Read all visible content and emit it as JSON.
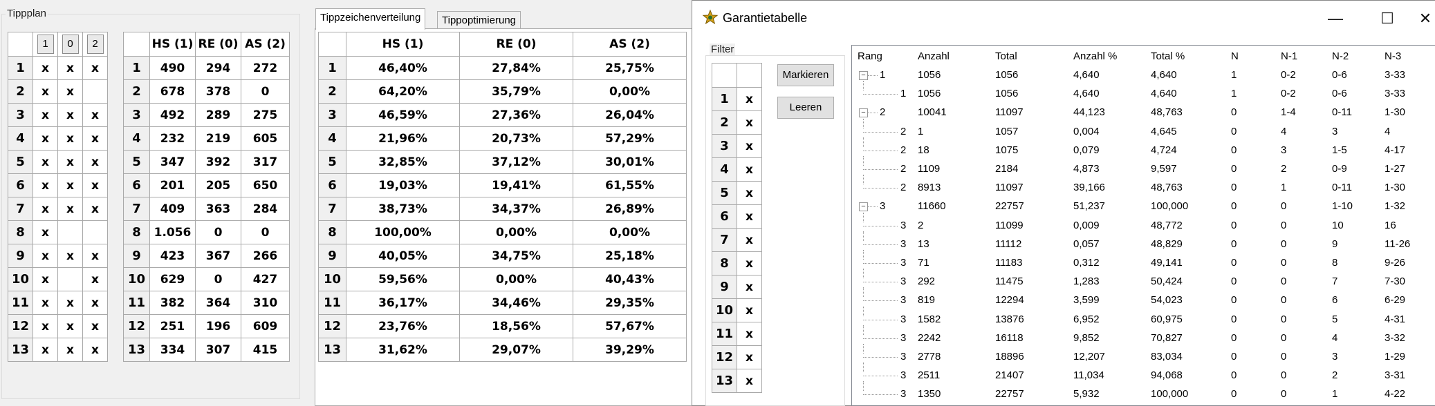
{
  "tippplan": {
    "title": "Tippplan",
    "headers": [
      "1",
      "0",
      "2"
    ],
    "rows": [
      {
        "n": "1",
        "c": [
          "x",
          "x",
          "x"
        ]
      },
      {
        "n": "2",
        "c": [
          "x",
          "x",
          ""
        ]
      },
      {
        "n": "3",
        "c": [
          "x",
          "x",
          "x"
        ]
      },
      {
        "n": "4",
        "c": [
          "x",
          "x",
          "x"
        ]
      },
      {
        "n": "5",
        "c": [
          "x",
          "x",
          "x"
        ]
      },
      {
        "n": "6",
        "c": [
          "x",
          "x",
          "x"
        ]
      },
      {
        "n": "7",
        "c": [
          "x",
          "x",
          "x"
        ]
      },
      {
        "n": "8",
        "c": [
          "x",
          "",
          ""
        ]
      },
      {
        "n": "9",
        "c": [
          "x",
          "x",
          "x"
        ]
      },
      {
        "n": "10",
        "c": [
          "x",
          "",
          "x"
        ]
      },
      {
        "n": "11",
        "c": [
          "x",
          "x",
          "x"
        ]
      },
      {
        "n": "12",
        "c": [
          "x",
          "x",
          "x"
        ]
      },
      {
        "n": "13",
        "c": [
          "x",
          "x",
          "x"
        ]
      }
    ]
  },
  "counts": {
    "headers": [
      "HS (1)",
      "RE (0)",
      "AS (2)"
    ],
    "rows": [
      {
        "n": "1",
        "c": [
          "490",
          "294",
          "272"
        ]
      },
      {
        "n": "2",
        "c": [
          "678",
          "378",
          "0"
        ]
      },
      {
        "n": "3",
        "c": [
          "492",
          "289",
          "275"
        ]
      },
      {
        "n": "4",
        "c": [
          "232",
          "219",
          "605"
        ]
      },
      {
        "n": "5",
        "c": [
          "347",
          "392",
          "317"
        ]
      },
      {
        "n": "6",
        "c": [
          "201",
          "205",
          "650"
        ]
      },
      {
        "n": "7",
        "c": [
          "409",
          "363",
          "284"
        ]
      },
      {
        "n": "8",
        "c": [
          "1.056",
          "0",
          "0"
        ]
      },
      {
        "n": "9",
        "c": [
          "423",
          "367",
          "266"
        ]
      },
      {
        "n": "10",
        "c": [
          "629",
          "0",
          "427"
        ]
      },
      {
        "n": "11",
        "c": [
          "382",
          "364",
          "310"
        ]
      },
      {
        "n": "12",
        "c": [
          "251",
          "196",
          "609"
        ]
      },
      {
        "n": "13",
        "c": [
          "334",
          "307",
          "415"
        ]
      }
    ]
  },
  "tabs": {
    "items": [
      "Tippzeichenverteilung",
      "Tippoptimierung"
    ]
  },
  "percent": {
    "headers": [
      "HS (1)",
      "RE (0)",
      "AS (2)"
    ],
    "rows": [
      {
        "n": "1",
        "c": [
          "46,40%",
          "27,84%",
          "25,75%"
        ]
      },
      {
        "n": "2",
        "c": [
          "64,20%",
          "35,79%",
          "0,00%"
        ]
      },
      {
        "n": "3",
        "c": [
          "46,59%",
          "27,36%",
          "26,04%"
        ]
      },
      {
        "n": "4",
        "c": [
          "21,96%",
          "20,73%",
          "57,29%"
        ]
      },
      {
        "n": "5",
        "c": [
          "32,85%",
          "37,12%",
          "30,01%"
        ]
      },
      {
        "n": "6",
        "c": [
          "19,03%",
          "19,41%",
          "61,55%"
        ]
      },
      {
        "n": "7",
        "c": [
          "38,73%",
          "34,37%",
          "26,89%"
        ]
      },
      {
        "n": "8",
        "c": [
          "100,00%",
          "0,00%",
          "0,00%"
        ]
      },
      {
        "n": "9",
        "c": [
          "40,05%",
          "34,75%",
          "25,18%"
        ]
      },
      {
        "n": "10",
        "c": [
          "59,56%",
          "0,00%",
          "40,43%"
        ]
      },
      {
        "n": "11",
        "c": [
          "36,17%",
          "34,46%",
          "29,35%"
        ]
      },
      {
        "n": "12",
        "c": [
          "23,76%",
          "18,56%",
          "57,67%"
        ]
      },
      {
        "n": "13",
        "c": [
          "31,62%",
          "29,07%",
          "39,29%"
        ]
      }
    ]
  },
  "dialog": {
    "title": "Garantietabelle",
    "controls": {
      "minimize": "—",
      "maximize": "☐",
      "close": "✕"
    },
    "filter": {
      "title": "Filter",
      "rows": [
        {
          "n": "1",
          "v": "x"
        },
        {
          "n": "2",
          "v": "x"
        },
        {
          "n": "3",
          "v": "x"
        },
        {
          "n": "4",
          "v": "x"
        },
        {
          "n": "5",
          "v": "x"
        },
        {
          "n": "6",
          "v": "x"
        },
        {
          "n": "7",
          "v": "x"
        },
        {
          "n": "8",
          "v": "x"
        },
        {
          "n": "9",
          "v": "x"
        },
        {
          "n": "10",
          "v": "x"
        },
        {
          "n": "11",
          "v": "x"
        },
        {
          "n": "12",
          "v": "x"
        },
        {
          "n": "13",
          "v": "x"
        }
      ]
    },
    "buttons": {
      "mark": "Markieren",
      "clear": "Leeren"
    },
    "tree": {
      "columns": [
        "Rang",
        "Anzahl",
        "Total",
        "Anzahl %",
        "Total %",
        "N",
        "N-1",
        "N-2",
        "N-3"
      ],
      "rows": [
        {
          "group": true,
          "rang": "1",
          "c": [
            "1056",
            "1056",
            "4,640",
            "4,640",
            "1",
            "0-2",
            "0-6",
            "3-33"
          ]
        },
        {
          "group": false,
          "rang": "1",
          "c": [
            "1056",
            "1056",
            "4,640",
            "4,640",
            "1",
            "0-2",
            "0-6",
            "3-33"
          ]
        },
        {
          "group": true,
          "rang": "2",
          "c": [
            "10041",
            "11097",
            "44,123",
            "48,763",
            "0",
            "1-4",
            "0-11",
            "1-30"
          ]
        },
        {
          "group": false,
          "rang": "2",
          "c": [
            "1",
            "1057",
            "0,004",
            "4,645",
            "0",
            "4",
            "3",
            "4"
          ]
        },
        {
          "group": false,
          "rang": "2",
          "c": [
            "18",
            "1075",
            "0,079",
            "4,724",
            "0",
            "3",
            "1-5",
            "4-17"
          ]
        },
        {
          "group": false,
          "rang": "2",
          "c": [
            "1109",
            "2184",
            "4,873",
            "9,597",
            "0",
            "2",
            "0-9",
            "1-27"
          ]
        },
        {
          "group": false,
          "rang": "2",
          "c": [
            "8913",
            "11097",
            "39,166",
            "48,763",
            "0",
            "1",
            "0-11",
            "1-30"
          ]
        },
        {
          "group": true,
          "rang": "3",
          "c": [
            "11660",
            "22757",
            "51,237",
            "100,000",
            "0",
            "0",
            "1-10",
            "1-32"
          ]
        },
        {
          "group": false,
          "rang": "3",
          "c": [
            "2",
            "11099",
            "0,009",
            "48,772",
            "0",
            "0",
            "10",
            "16"
          ]
        },
        {
          "group": false,
          "rang": "3",
          "c": [
            "13",
            "11112",
            "0,057",
            "48,829",
            "0",
            "0",
            "9",
            "11-26"
          ]
        },
        {
          "group": false,
          "rang": "3",
          "c": [
            "71",
            "11183",
            "0,312",
            "49,141",
            "0",
            "0",
            "8",
            "9-26"
          ]
        },
        {
          "group": false,
          "rang": "3",
          "c": [
            "292",
            "11475",
            "1,283",
            "50,424",
            "0",
            "0",
            "7",
            "7-30"
          ]
        },
        {
          "group": false,
          "rang": "3",
          "c": [
            "819",
            "12294",
            "3,599",
            "54,023",
            "0",
            "0",
            "6",
            "6-29"
          ]
        },
        {
          "group": false,
          "rang": "3",
          "c": [
            "1582",
            "13876",
            "6,952",
            "60,975",
            "0",
            "0",
            "5",
            "4-31"
          ]
        },
        {
          "group": false,
          "rang": "3",
          "c": [
            "2242",
            "16118",
            "9,852",
            "70,827",
            "0",
            "0",
            "4",
            "3-32"
          ]
        },
        {
          "group": false,
          "rang": "3",
          "c": [
            "2778",
            "18896",
            "12,207",
            "83,034",
            "0",
            "0",
            "3",
            "1-29"
          ]
        },
        {
          "group": false,
          "rang": "3",
          "c": [
            "2511",
            "21407",
            "11,034",
            "94,068",
            "0",
            "0",
            "2",
            "3-31"
          ]
        },
        {
          "group": false,
          "rang": "3",
          "c": [
            "1350",
            "22757",
            "5,932",
            "100,000",
            "0",
            "0",
            "1",
            "4-22"
          ]
        }
      ]
    }
  },
  "colors": {
    "accent": "#0078d7",
    "window_bg": "#f0f0f0",
    "grid_line": "#a9a9a9"
  }
}
